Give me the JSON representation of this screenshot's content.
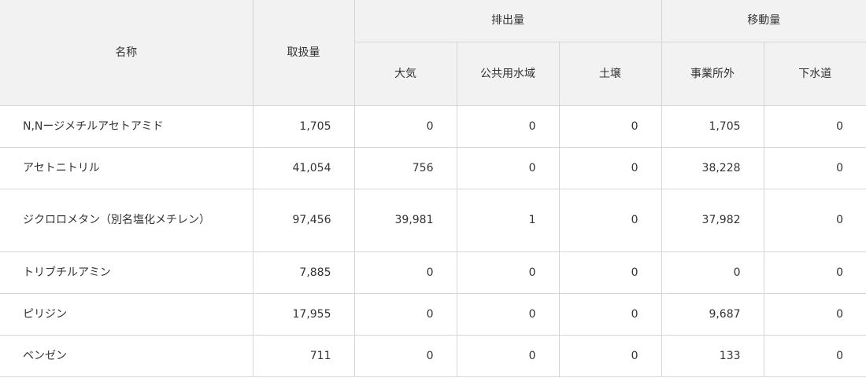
{
  "headers": {
    "name": "名称",
    "handled": "取扱量",
    "emission": "排出量",
    "transfer": "移動量",
    "air": "大気",
    "public_water": "公共用水域",
    "soil": "土壌",
    "offsite": "事業所外",
    "sewer": "下水道"
  },
  "rows": [
    {
      "name": "N,Nージメチルアセトアミド",
      "handled": "1,705",
      "air": "0",
      "public_water": "0",
      "soil": "0",
      "offsite": "1,705",
      "sewer": "0"
    },
    {
      "name": "アセトニトリル",
      "handled": "41,054",
      "air": "756",
      "public_water": "0",
      "soil": "0",
      "offsite": "38,228",
      "sewer": "0"
    },
    {
      "name": "ジクロロメタン（別名塩化メチレン）",
      "handled": "97,456",
      "air": "39,981",
      "public_water": "1",
      "soil": "0",
      "offsite": "37,982",
      "sewer": "0"
    },
    {
      "name": "トリブチルアミン",
      "handled": "7,885",
      "air": "0",
      "public_water": "0",
      "soil": "0",
      "offsite": "0",
      "sewer": "0"
    },
    {
      "name": "ピリジン",
      "handled": "17,955",
      "air": "0",
      "public_water": "0",
      "soil": "0",
      "offsite": "9,687",
      "sewer": "0"
    },
    {
      "name": "ベンゼン",
      "handled": "711",
      "air": "0",
      "public_water": "0",
      "soil": "0",
      "offsite": "133",
      "sewer": "0"
    }
  ]
}
